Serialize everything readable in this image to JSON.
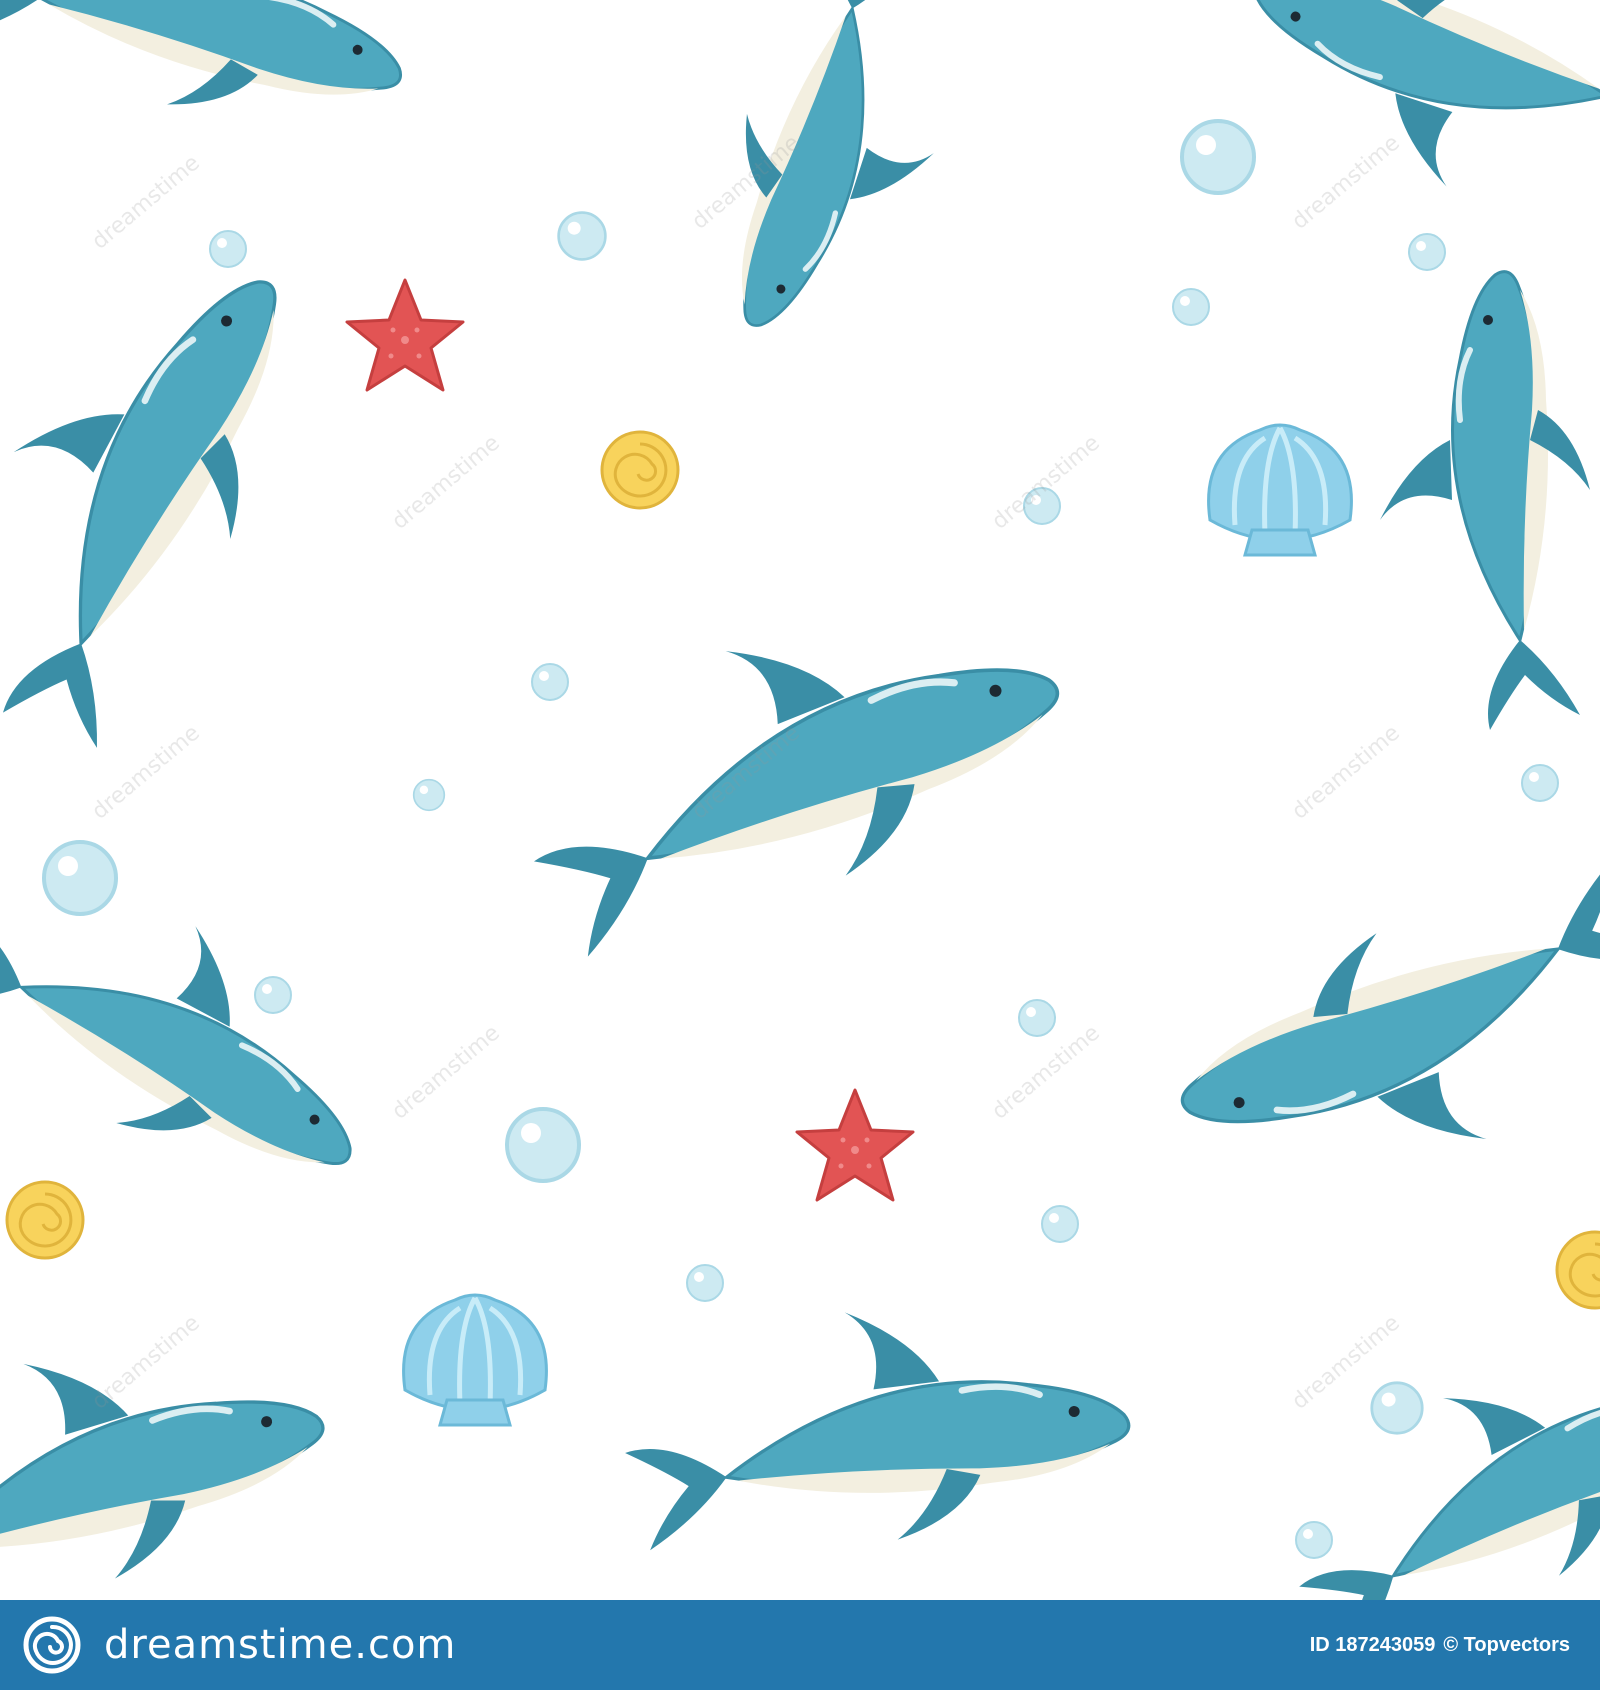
{
  "colors": {
    "background": "#ffffff",
    "dolphin_body": "#4ea8bf",
    "dolphin_dark": "#3a8ea6",
    "dolphin_belly": "#f3efe0",
    "starfish": "#e25454",
    "snail_shell": "#f8d35c",
    "scallop_shell": "#8fd0ea",
    "bubble": "#cdeaf2",
    "footer": "#2377ad"
  },
  "watermark_text": "dreamstime",
  "footer": {
    "brand_icon": "dreamstime-spiral-icon",
    "brand_name": "dreamstime.com",
    "image_id": "ID 187243059",
    "credit": "© Topvectors"
  }
}
